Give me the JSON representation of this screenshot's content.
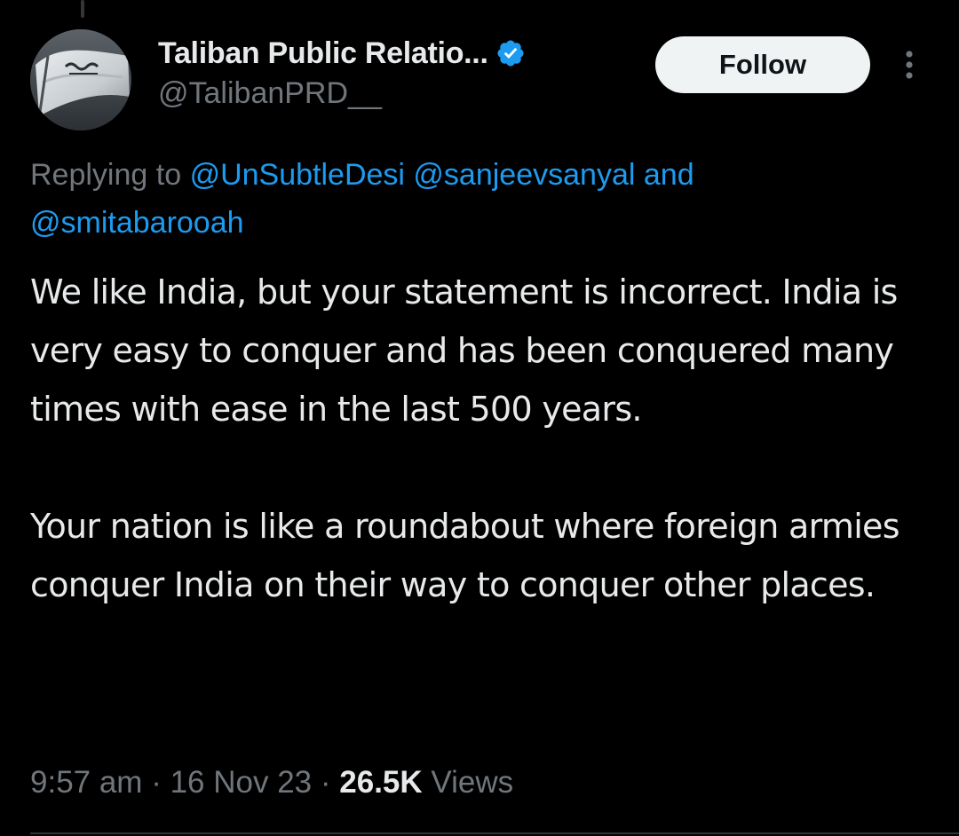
{
  "author": {
    "display_name": "Taliban Public Relatio...",
    "handle": "@TalibanPRD__",
    "verified": true
  },
  "follow_button": {
    "label": "Follow"
  },
  "reply_context": {
    "prefix": "Replying to",
    "mention_1": "@UnSubtleDesi",
    "mention_2": "@sanjeevsanyal",
    "conjunction": "and",
    "mention_3": "@smitabarooah"
  },
  "tweet": {
    "paragraph_1": "We like India, but your statement is incorrect. India is very easy to conquer and has been conquered many times with ease in the last 500 years.",
    "paragraph_2": "Your nation is like a roundabout where foreign armies conquer India on their way to conquer other places."
  },
  "meta": {
    "time": "9:57 am",
    "separator": "·",
    "date": "16 Nov 23",
    "views_count": "26.5K",
    "views_label": "Views"
  },
  "icons": {
    "verified": "verified-badge-icon",
    "more": "more-options-icon"
  },
  "colors": {
    "background": "#000000",
    "text_primary": "#e7e9ea",
    "text_secondary": "#71767b",
    "link": "#1d9bf0",
    "verified_badge": "#1d9bf0",
    "follow_button_bg": "#eff3f4",
    "follow_button_text": "#0f1419"
  }
}
